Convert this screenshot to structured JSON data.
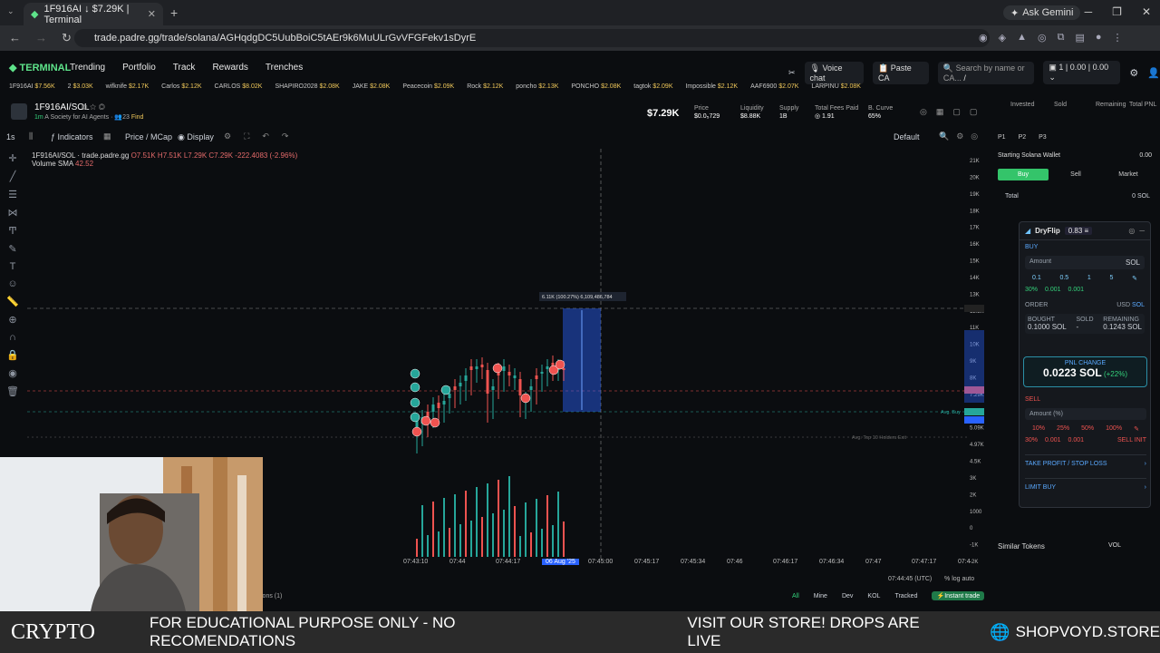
{
  "browser": {
    "tab_title": "1F916AI ↓ $7.29K | Terminal",
    "ask_gemini": "Ask Gemini",
    "url": "trade.padre.gg/trade/solana/AGHqdgDC5UubBoiC5tAEr9k6MuULrGvVFGFekv1sDyrE"
  },
  "appnav": {
    "logo": "TERMINAL",
    "links": [
      "Trending",
      "Portfolio",
      "Track",
      "Rewards",
      "Trenches"
    ],
    "voice_chat": "Voice chat",
    "paste_ca": "Paste CA",
    "search_placeholder": "Search by name or CA...",
    "search_shortcut": "/",
    "wallet_count": "1",
    "balance_1": "0.00",
    "balance_2": "0.00"
  },
  "ticker": [
    {
      "name": "1F916AI",
      "value": "$7.56K"
    },
    {
      "name": "2",
      "value": "$3.03K"
    },
    {
      "name": "wifknife",
      "value": "$2.17K"
    },
    {
      "name": "Carlos",
      "value": "$2.12K"
    },
    {
      "name": "CARLOS",
      "value": "$8.02K"
    },
    {
      "name": "SHAPIRO2028",
      "value": "$2.08K"
    },
    {
      "name": "JAKE",
      "value": "$2.08K"
    },
    {
      "name": "Peacecoin",
      "value": "$2.09K"
    },
    {
      "name": "Rock",
      "value": "$2.12K"
    },
    {
      "name": "poncho",
      "value": "$2.13K"
    },
    {
      "name": "PONCHO",
      "value": "$2.08K"
    },
    {
      "name": "tagtok",
      "value": "$2.09K"
    },
    {
      "name": "Impossible",
      "value": "$2.12K"
    },
    {
      "name": "AAF6900",
      "value": "$2.07K"
    },
    {
      "name": "LARPINU",
      "value": "$2.08K"
    }
  ],
  "token": {
    "name": "1F916AI/SOL",
    "age": "1m",
    "description": "A Society for AI Agents",
    "holders": "23",
    "find": "Find",
    "price": "$7.29K",
    "stats": [
      {
        "label": "Price",
        "value": "$0.0₅729"
      },
      {
        "label": "Liquidity",
        "value": "$8.88K"
      },
      {
        "label": "Supply",
        "value": "1B"
      },
      {
        "label": "Total Fees Paid",
        "value": "◎ 1.91"
      },
      {
        "label": "B. Curve",
        "value": "65%"
      }
    ]
  },
  "toolbar": {
    "interval": "1s",
    "indicators": "Indicators",
    "price_mcap": "Price / MCap",
    "display": "Display",
    "default": "Default"
  },
  "chart_legend": {
    "pair": "1F916AI/SOL · trade.padre.gg",
    "ohlc": "O7.51K H7.51K L7.29K C7.29K -222.4083 (-2.96%)",
    "volume": "Volume SMA",
    "volume_value": "42.52"
  },
  "chart_data": {
    "type": "candlestick",
    "y_ticks": [
      "21K",
      "20K",
      "19K",
      "18K",
      "17K",
      "16K",
      "15K",
      "14K",
      "13K",
      "12.2K",
      "11K",
      "10K",
      "9K",
      "8K",
      "7.29K",
      "6.09K",
      "5.09K",
      "4.97K",
      "4.5K",
      "3K",
      "2K",
      "1000",
      "0",
      "-1K",
      "-2K"
    ],
    "x_ticks": [
      "07:43:10",
      "07:44",
      "07:44:17",
      "06 Aug '25",
      "07:45:00",
      "07:45:17",
      "07:45:34",
      "07:46",
      "07:46:17",
      "07:46:34",
      "07:47",
      "07:47:17",
      "07:4"
    ],
    "measure_label": "6.11K (100.27%) 6,109,486,784",
    "avg_buy_label": "Avg. Buy",
    "limit_label": "Avg. Top 10 Holders Exit",
    "time_utc": "07:44:45 (UTC)",
    "scale_opts": [
      "%",
      "log",
      "auto"
    ]
  },
  "bottombar": {
    "filters": [
      "All",
      "Mine",
      "Dev",
      "KOL",
      "Tracked"
    ],
    "instant_trade": "Instant trade",
    "tab": "ions (1)"
  },
  "rightpanel": {
    "headers": [
      "Invested",
      "Sold",
      "Remaining",
      "Total PNL"
    ],
    "presets": [
      "P1",
      "P2",
      "P3"
    ],
    "wallet": "Starting Solana Wallet",
    "wallet_bal": "0.00",
    "buy": "Buy",
    "sell": "Sell",
    "market": "Market",
    "total": "Total",
    "total_val": "0 SOL",
    "similar": "Similar Tokens",
    "vol": "VOL"
  },
  "dryflip": {
    "title": "DryFlip",
    "badge": "0.83",
    "buy": "BUY",
    "amount": "Amount",
    "sol": "SOL",
    "quick": [
      "0.1",
      "0.5",
      "1",
      "5"
    ],
    "fees": [
      "30%",
      "0.001",
      "0.001"
    ],
    "order": "ORDER",
    "usd": "USD",
    "bought_l": "BOUGHT",
    "bought_v": "0.1000 SOL",
    "sold_l": "SOLD",
    "sold_v": "-",
    "remaining_l": "REMAINING",
    "remaining_v": "0.1243 SOL",
    "pnl_l": "PNL CHANGE",
    "pnl_v": "0.0223 SOL",
    "pnl_p": "(+22%)",
    "sell": "SELL",
    "amount_pct": "Amount (%)",
    "pcts": [
      "10%",
      "25%",
      "50%",
      "100%"
    ],
    "sell_fees": [
      "30%",
      "0.001",
      "0.001"
    ],
    "sell_init": "SELL INIT",
    "tpsl": "TAKE PROFIT / STOP LOSS",
    "limit": "LIMIT BUY"
  },
  "banner": {
    "crypto": "CRYPTO",
    "msg": "FOR EDUCATIONAL PURPOSE ONLY - NO RECOMENDATIONS",
    "store": "VISIT OUR STORE! DROPS ARE LIVE",
    "shop": "SHOPVOYD.STORE"
  },
  "colors": {
    "accent": "#34d27b",
    "down": "#ef5350",
    "up": "#26a69a",
    "measure": "#2962ff"
  }
}
